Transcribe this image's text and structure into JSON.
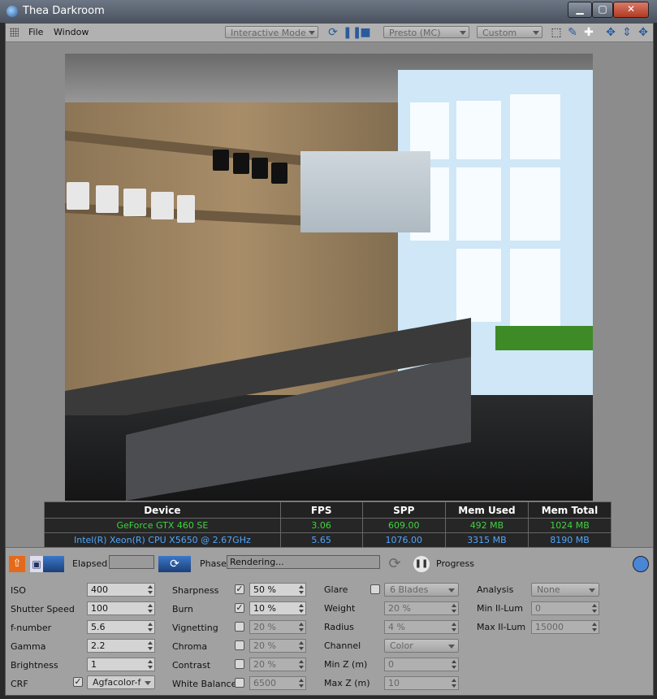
{
  "window": {
    "title": "Thea Darkroom"
  },
  "menu": {
    "file": "File",
    "window": "Window"
  },
  "toolbar": {
    "mode": "Interactive Mode",
    "engine": "Presto (MC)",
    "preset": "Custom"
  },
  "table": {
    "headers": [
      "Device",
      "FPS",
      "SPP",
      "Mem Used",
      "Mem Total"
    ],
    "rows": [
      [
        "GeForce GTX 460 SE",
        "3.06",
        "609.00",
        "492 MB",
        "1024 MB"
      ],
      [
        "Intel(R) Xeon(R) CPU X5650 @ 2.67GHz",
        "5.65",
        "1076.00",
        "3315 MB",
        "8190 MB"
      ]
    ]
  },
  "control": {
    "elapsed_label": "Elapsed",
    "elapsed_value": "",
    "phase_label": "Phase",
    "phase_value": "Rendering...",
    "progress_label": "Progress"
  },
  "params": {
    "iso": {
      "label": "ISO",
      "value": "400"
    },
    "shutter": {
      "label": "Shutter Speed",
      "value": "100"
    },
    "fnumber": {
      "label": "f-number",
      "value": "5.6"
    },
    "gamma": {
      "label": "Gamma",
      "value": "2.2"
    },
    "brightness": {
      "label": "Brightness",
      "value": "1"
    },
    "crf": {
      "label": "CRF",
      "value": "Agfacolor-f"
    },
    "sharpness": {
      "label": "Sharpness",
      "value": "50 %"
    },
    "burn": {
      "label": "Burn",
      "value": "10 %"
    },
    "vignetting": {
      "label": "Vignetting",
      "value": "20 %"
    },
    "chroma": {
      "label": "Chroma",
      "value": "20 %"
    },
    "contrast": {
      "label": "Contrast",
      "value": "20 %"
    },
    "whitebalance": {
      "label": "White Balance",
      "value": "6500"
    },
    "glare": {
      "label": "Glare",
      "value": "6 Blades"
    },
    "weight": {
      "label": "Weight",
      "value": "20 %"
    },
    "radius": {
      "label": "Radius",
      "value": "4 %"
    },
    "channel": {
      "label": "Channel",
      "value": "Color"
    },
    "minz": {
      "label": "Min Z (m)",
      "value": "0"
    },
    "maxz": {
      "label": "Max Z (m)",
      "value": "10"
    },
    "analysis": {
      "label": "Analysis",
      "value": "None"
    },
    "minillum": {
      "label": "Min Il-Lum",
      "value": "0"
    },
    "maxillum": {
      "label": "Max Il-Lum",
      "value": "15000"
    }
  }
}
